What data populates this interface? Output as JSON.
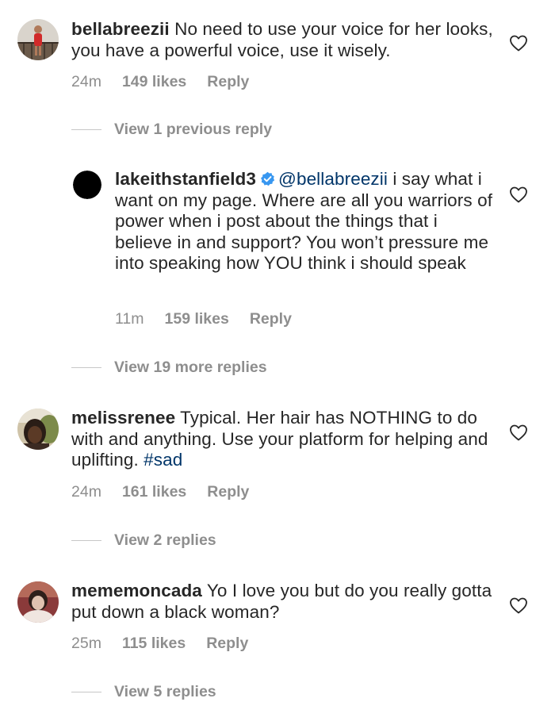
{
  "comments": [
    {
      "username": "bellabreezii",
      "text": " No need to use your voice for her looks, you have a powerful voice, use it wisely.",
      "time": "24m",
      "likes": "149 likes",
      "reply": "Reply"
    },
    {
      "username": "lakeithstanfield3",
      "mention": "@bellabreezii",
      "text": " i say what i want on my page. Where are all you warriors of power when i post about the things that i believe in and support? You won’t pressure me into speaking how YOU think i should speak",
      "time": "11m",
      "likes": "159 likes",
      "reply": "Reply",
      "verified": true
    },
    {
      "username": "melissrenee",
      "text": " Typical. Her hair has NOTHING to do with and anything. Use your platform for helping and uplifting. ",
      "hashtag": "#sad",
      "time": "24m",
      "likes": "161 likes",
      "reply": "Reply"
    },
    {
      "username": "mememoncada",
      "text": " Yo I love you but do you really gotta put down a black woman?",
      "time": "25m",
      "likes": "115 likes",
      "reply": "Reply"
    }
  ],
  "view_replies": [
    "View 1 previous reply",
    "View 19 more replies",
    "View 2 replies",
    "View 5 replies"
  ],
  "icons": {
    "like": "heart-outline-icon",
    "verified": "verified-badge-icon"
  },
  "colors": {
    "text": "#262626",
    "secondary": "#8e8e8e",
    "link": "#003569",
    "verified": "#3897f0"
  }
}
